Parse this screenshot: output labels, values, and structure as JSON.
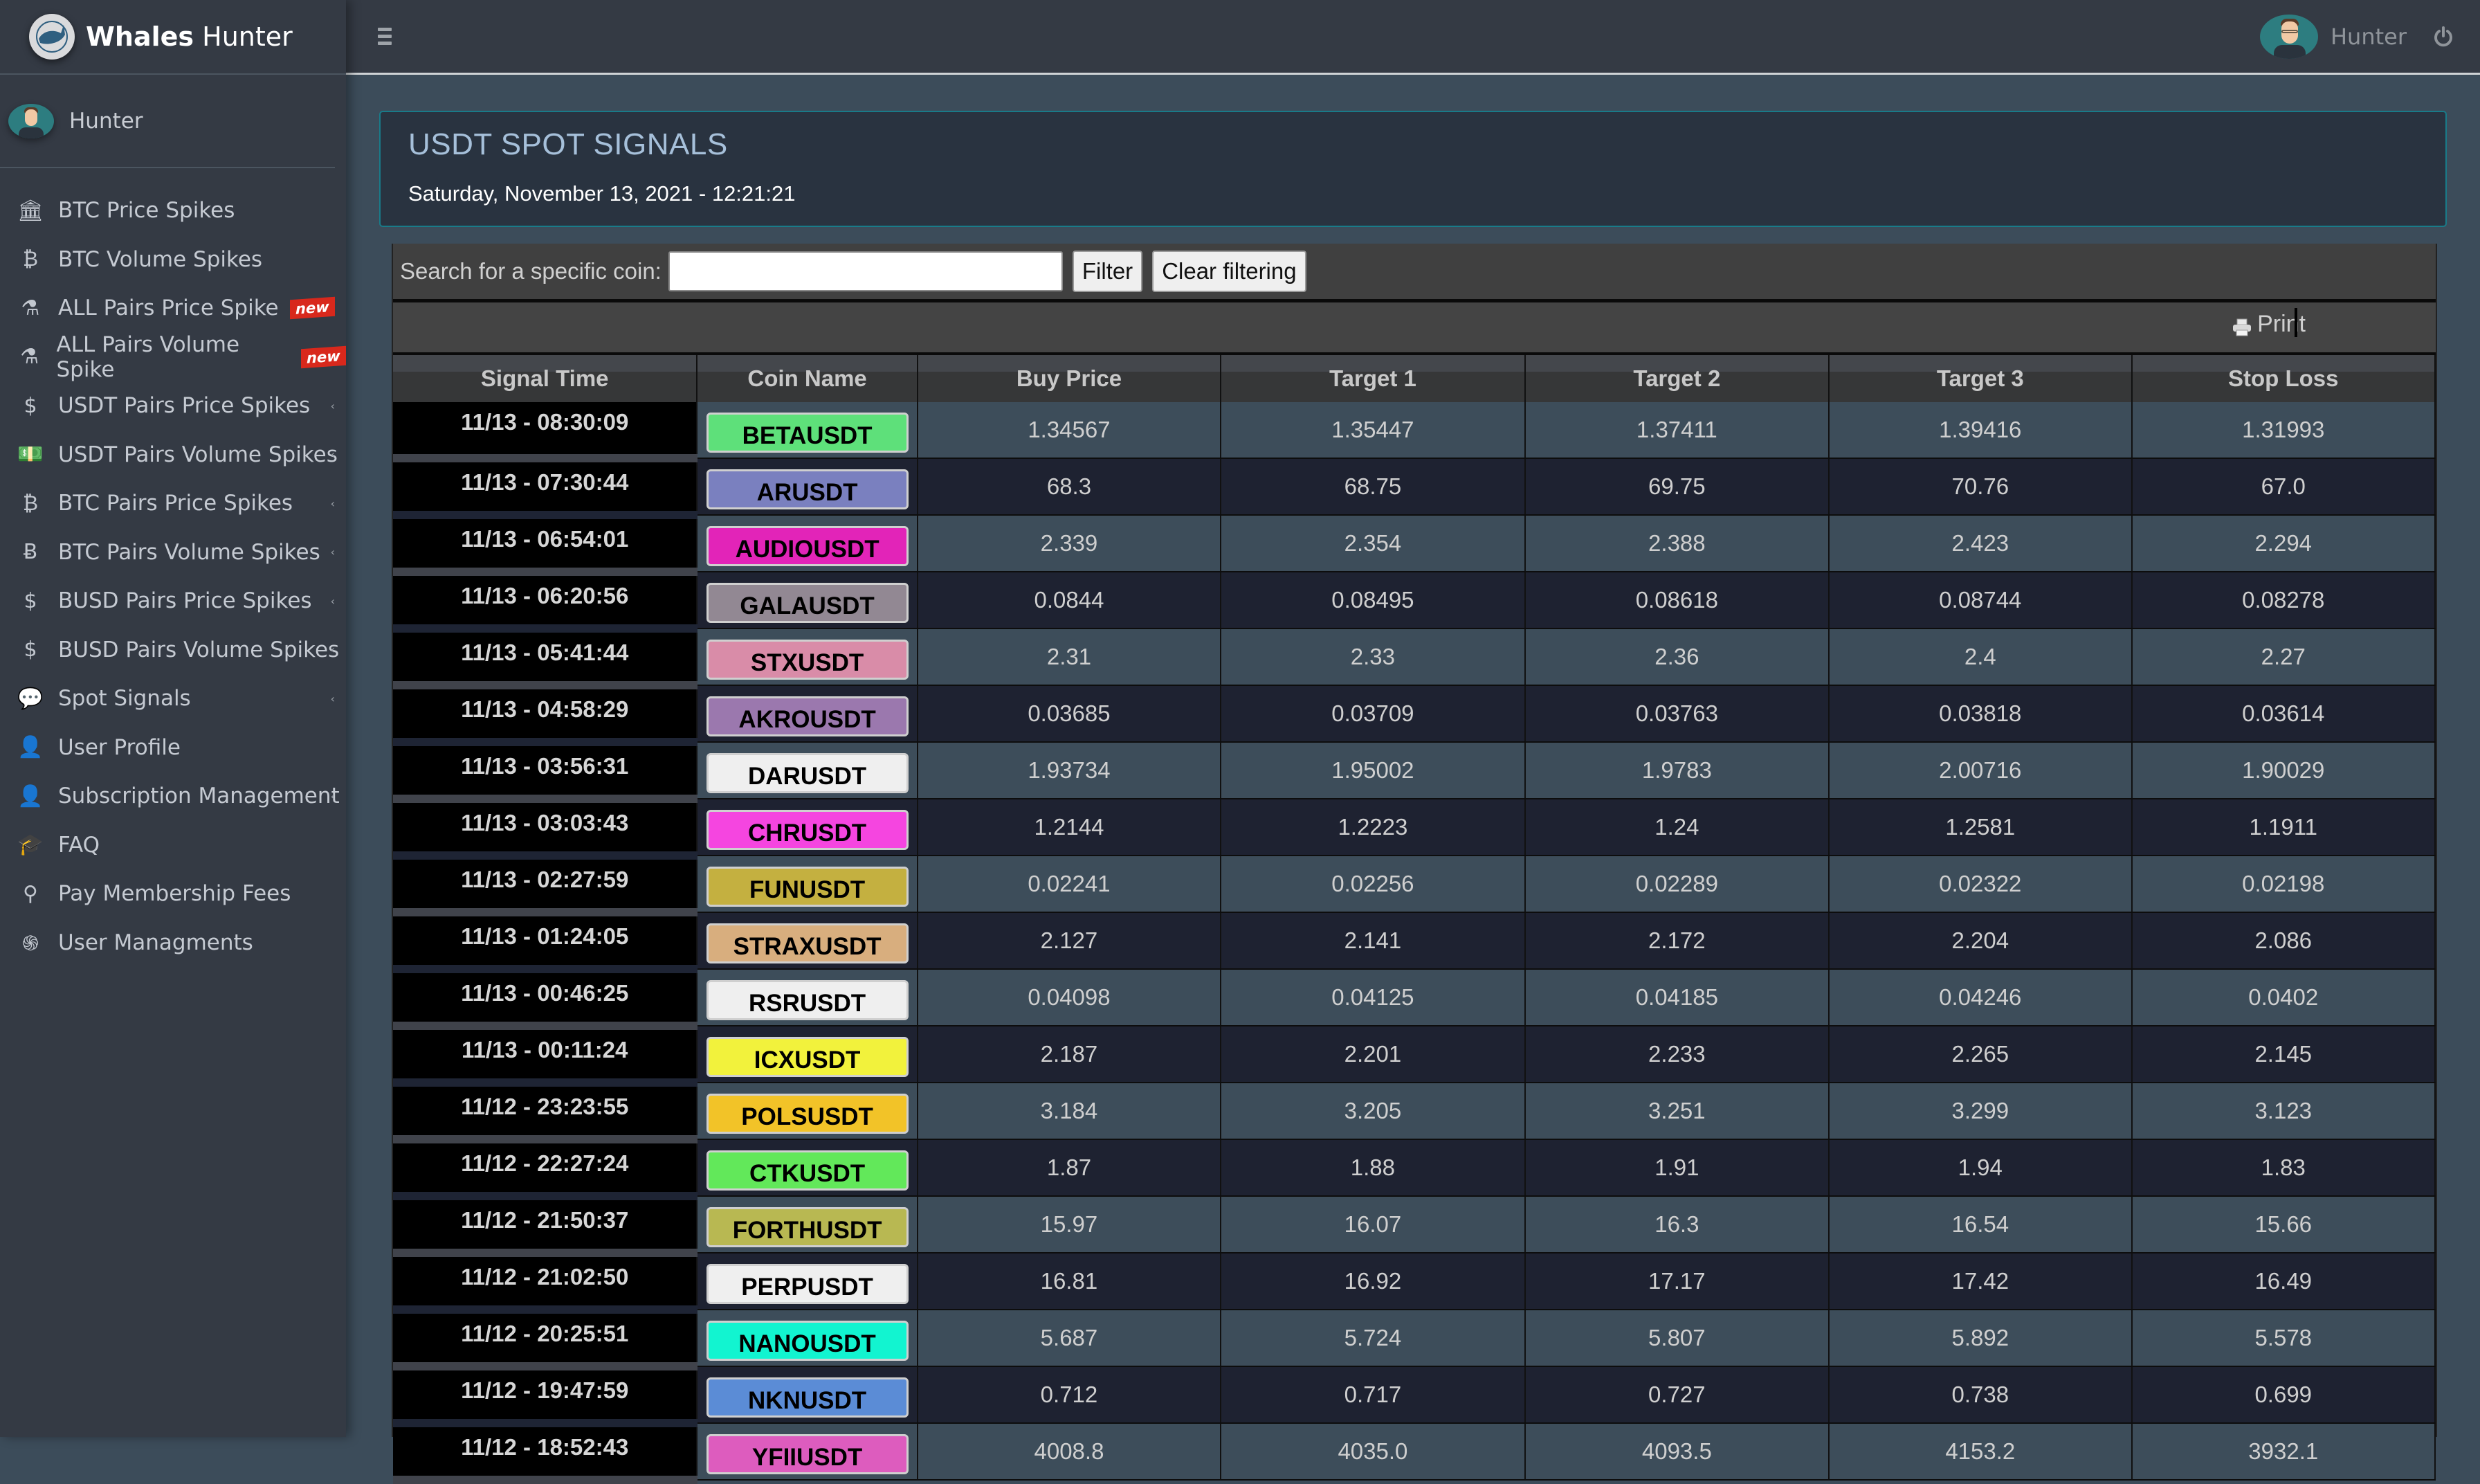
{
  "brand": {
    "bold": "Whales",
    "light": "Hunter"
  },
  "sidebar": {
    "user": "Hunter",
    "items": [
      {
        "label": "BTC Price Spikes",
        "icon": "bank-icon",
        "glyph": "🏛",
        "badge": null,
        "caret": false
      },
      {
        "label": "BTC Volume Spikes",
        "icon": "bitcoin-circle-icon",
        "glyph": "₿",
        "badge": null,
        "caret": false
      },
      {
        "label": "ALL Pairs Price Spike",
        "icon": "flask-icon",
        "glyph": "⚗",
        "badge": "new",
        "caret": false
      },
      {
        "label": "ALL Pairs Volume Spike",
        "icon": "flask-icon",
        "glyph": "⚗",
        "badge": "new",
        "caret": false
      },
      {
        "label": "USDT Pairs Price Spikes",
        "icon": "dollar-hand-icon",
        "glyph": "$",
        "badge": null,
        "caret": true
      },
      {
        "label": "USDT Pairs Volume Spikes",
        "icon": "banknote-icon",
        "glyph": "💵",
        "badge": null,
        "caret": true
      },
      {
        "label": "BTC Pairs Price Spikes",
        "icon": "bitcoin-circle-icon",
        "glyph": "₿",
        "badge": null,
        "caret": true
      },
      {
        "label": "BTC Pairs Volume Spikes",
        "icon": "bitcoin-icon",
        "glyph": "Ƀ",
        "badge": null,
        "caret": true
      },
      {
        "label": "BUSD Pairs Price Spikes",
        "icon": "dollar-icon",
        "glyph": "$",
        "badge": null,
        "caret": true
      },
      {
        "label": "BUSD Pairs Volume Spikes",
        "icon": "dollar-icon",
        "glyph": "$",
        "badge": null,
        "caret": true
      },
      {
        "label": "Spot Signals",
        "icon": "comment-dollar-icon",
        "glyph": "💬",
        "badge": null,
        "caret": true
      },
      {
        "label": "User Profile",
        "icon": "user-edit-icon",
        "glyph": "👤",
        "badge": null,
        "caret": false
      },
      {
        "label": "Subscription Management",
        "icon": "user-icon",
        "glyph": "👤",
        "badge": null,
        "caret": true
      },
      {
        "label": "FAQ",
        "icon": "graduation-cap-icon",
        "glyph": "🎓",
        "badge": null,
        "caret": false
      },
      {
        "label": "Pay Membership Fees",
        "icon": "lamp-icon",
        "glyph": "⚲",
        "badge": null,
        "caret": false
      },
      {
        "label": "User Managments",
        "icon": "fingerprint-icon",
        "glyph": "֍",
        "badge": null,
        "caret": false
      }
    ]
  },
  "topbar": {
    "user": "Hunter"
  },
  "page": {
    "title": "USDT SPOT SIGNALS",
    "date": "Saturday, November 13, 2021 - 12:21:21"
  },
  "filter": {
    "label": "Search for a specific coin:",
    "value": "",
    "placeholder": "",
    "filter_button": "Filter",
    "clear_button": "Clear filtering"
  },
  "print": {
    "label": "Print"
  },
  "table": {
    "columns": [
      "Signal Time",
      "Coin Name",
      "Buy Price",
      "Target 1",
      "Target 2",
      "Target 3",
      "Stop Loss"
    ],
    "rows": [
      {
        "time": "11/13 - 08:30:09",
        "coin": "BETAUSDT",
        "color": "#5ee07a",
        "buy": "1.34567",
        "t1": "1.35447",
        "t2": "1.37411",
        "t3": "1.39416",
        "sl": "1.31993"
      },
      {
        "time": "11/13 - 07:30:44",
        "coin": "ARUSDT",
        "color": "#7a80bf",
        "buy": "68.3",
        "t1": "68.75",
        "t2": "69.75",
        "t3": "70.76",
        "sl": "67.0"
      },
      {
        "time": "11/13 - 06:54:01",
        "coin": "AUDIOUSDT",
        "color": "#e224b8",
        "buy": "2.339",
        "t1": "2.354",
        "t2": "2.388",
        "t3": "2.423",
        "sl": "2.294"
      },
      {
        "time": "11/13 - 06:20:56",
        "coin": "GALAUSDT",
        "color": "#928893",
        "buy": "0.0844",
        "t1": "0.08495",
        "t2": "0.08618",
        "t3": "0.08744",
        "sl": "0.08278"
      },
      {
        "time": "11/13 - 05:41:44",
        "coin": "STXUSDT",
        "color": "#d98ca8",
        "buy": "2.31",
        "t1": "2.33",
        "t2": "2.36",
        "t3": "2.4",
        "sl": "2.27"
      },
      {
        "time": "11/13 - 04:58:29",
        "coin": "AKROUSDT",
        "color": "#9b78ae",
        "buy": "0.03685",
        "t1": "0.03709",
        "t2": "0.03763",
        "t3": "0.03818",
        "sl": "0.03614"
      },
      {
        "time": "11/13 - 03:56:31",
        "coin": "DARUSDT",
        "color": "#efefef",
        "buy": "1.93734",
        "t1": "1.95002",
        "t2": "1.9783",
        "t3": "2.00716",
        "sl": "1.90029"
      },
      {
        "time": "11/13 - 03:03:43",
        "coin": "CHRUSDT",
        "color": "#f545e0",
        "buy": "1.2144",
        "t1": "1.2223",
        "t2": "1.24",
        "t3": "1.2581",
        "sl": "1.1911"
      },
      {
        "time": "11/13 - 02:27:59",
        "coin": "FUNUSDT",
        "color": "#c4b040",
        "buy": "0.02241",
        "t1": "0.02256",
        "t2": "0.02289",
        "t3": "0.02322",
        "sl": "0.02198"
      },
      {
        "time": "11/13 - 01:24:05",
        "coin": "STRAXUSDT",
        "color": "#d8ae7e",
        "buy": "2.127",
        "t1": "2.141",
        "t2": "2.172",
        "t3": "2.204",
        "sl": "2.086"
      },
      {
        "time": "11/13 - 00:46:25",
        "coin": "RSRUSDT",
        "color": "#efefef",
        "buy": "0.04098",
        "t1": "0.04125",
        "t2": "0.04185",
        "t3": "0.04246",
        "sl": "0.0402"
      },
      {
        "time": "11/13 - 00:11:24",
        "coin": "ICXUSDT",
        "color": "#f2f23c",
        "buy": "2.187",
        "t1": "2.201",
        "t2": "2.233",
        "t3": "2.265",
        "sl": "2.145"
      },
      {
        "time": "11/12 - 23:23:55",
        "coin": "POLSUSDT",
        "color": "#f2c328",
        "buy": "3.184",
        "t1": "3.205",
        "t2": "3.251",
        "t3": "3.299",
        "sl": "3.123"
      },
      {
        "time": "11/12 - 22:27:24",
        "coin": "CTKUSDT",
        "color": "#62e85a",
        "buy": "1.87",
        "t1": "1.88",
        "t2": "1.91",
        "t3": "1.94",
        "sl": "1.83"
      },
      {
        "time": "11/12 - 21:50:37",
        "coin": "FORTHUSDT",
        "color": "#b8b852",
        "buy": "15.97",
        "t1": "16.07",
        "t2": "16.3",
        "t3": "16.54",
        "sl": "15.66"
      },
      {
        "time": "11/12 - 21:02:50",
        "coin": "PERPUSDT",
        "color": "#efefef",
        "buy": "16.81",
        "t1": "16.92",
        "t2": "17.17",
        "t3": "17.42",
        "sl": "16.49"
      },
      {
        "time": "11/12 - 20:25:51",
        "coin": "NANOUSDT",
        "color": "#12f4d0",
        "buy": "5.687",
        "t1": "5.724",
        "t2": "5.807",
        "t3": "5.892",
        "sl": "5.578"
      },
      {
        "time": "11/12 - 19:47:59",
        "coin": "NKNUSDT",
        "color": "#5b8cd6",
        "buy": "0.712",
        "t1": "0.717",
        "t2": "0.727",
        "t3": "0.738",
        "sl": "0.699"
      },
      {
        "time": "11/12 - 18:52:43",
        "coin": "YFIIUSDT",
        "color": "#dd5cbe",
        "buy": "4008.8",
        "t1": "4035.0",
        "t2": "4093.5",
        "t3": "4153.2",
        "sl": "3932.1"
      }
    ]
  }
}
